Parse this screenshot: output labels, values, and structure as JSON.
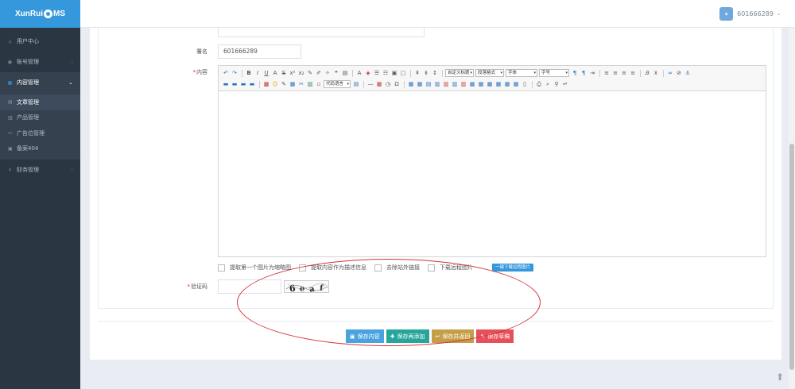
{
  "logo": {
    "text_before": "XunRui",
    "text_after": "MS"
  },
  "sidebar": {
    "items": [
      {
        "label": "用户中心",
        "icon": "home-icon"
      },
      {
        "label": "账号管理",
        "icon": "user-icon"
      },
      {
        "label": "内容管理",
        "icon": "grid-icon"
      },
      {
        "label": "财务管理",
        "icon": "yen-icon"
      }
    ],
    "submenu": [
      {
        "label": "文章管理",
        "icon": "article-icon"
      },
      {
        "label": "产品管理",
        "icon": "product-icon"
      },
      {
        "label": "广告位管理",
        "icon": "image-icon"
      },
      {
        "label": "备案404",
        "icon": "calendar-icon"
      }
    ]
  },
  "header": {
    "username": "601666289"
  },
  "form": {
    "signature_label": "署名",
    "signature_value": "601666289",
    "content_label": "内容",
    "captcha_label": "验证码",
    "options": [
      "提取第一个图片为缩略图",
      "提取内容作为描述信息",
      "去除站外链接",
      "下载远程图片"
    ],
    "download_button": "一键下载远程图片"
  },
  "editor": {
    "selects": {
      "custom_title": "自定义标题",
      "paragraph": "段落格式",
      "font": "字体",
      "size": "字号",
      "code_lang": "代码语言"
    }
  },
  "actions": [
    {
      "label": "保存内容",
      "icon": "save-icon"
    },
    {
      "label": "保存再添加",
      "icon": "plus-icon"
    },
    {
      "label": "保存并返回",
      "icon": "reply-icon"
    },
    {
      "label": "保存草稿",
      "icon": "pencil-icon"
    }
  ],
  "colors": {
    "sidebar_bg": "#2b3643",
    "brand": "#3598dc",
    "annotation": "#d3353a",
    "btn_save": "#4aa3df",
    "btn_add": "#26a69a",
    "btn_return": "#c49f47",
    "btn_draft": "#e7505a"
  }
}
